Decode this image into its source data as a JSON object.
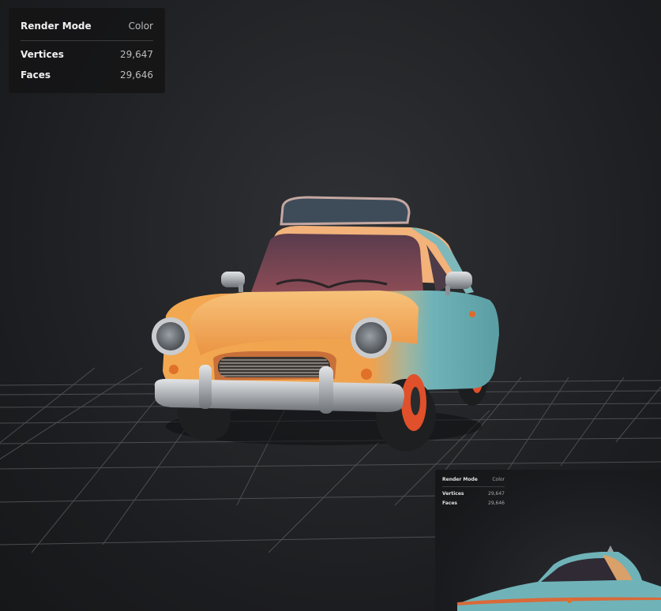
{
  "stats": {
    "render_mode_label": "Render Mode",
    "render_mode_value": "Color",
    "vertices_label": "Vertices",
    "vertices_value": "29,647",
    "faces_label": "Faces",
    "faces_value": "29,646"
  },
  "thumbnail": {
    "render_mode_label": "Render Mode",
    "render_mode_value": "Color",
    "vertices_label": "Vertices",
    "vertices_value": "29,647",
    "faces_label": "Faces",
    "faces_value": "29,646"
  },
  "colors": {
    "body_orange": "#f0a24e",
    "body_teal": "#6fb3b8",
    "chrome": "#b9bcbf",
    "wheel_red": "#e0502a",
    "windshield": "#6b3a4a",
    "grid_line": "#6a6b6e"
  }
}
